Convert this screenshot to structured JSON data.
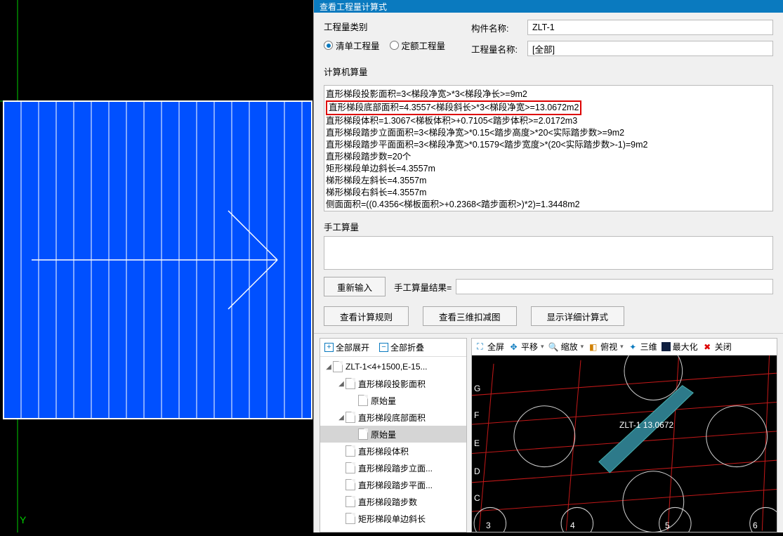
{
  "dialog": {
    "title": "查看工程量计算式"
  },
  "quantity_type": {
    "label": "工程量类别",
    "opt1": "清单工程量",
    "opt2": "定额工程量"
  },
  "fields": {
    "component_label": "构件名称:",
    "component_value": "ZLT-1",
    "quantity_name_label": "工程量名称:",
    "quantity_name_value": "[全部]"
  },
  "calc": {
    "label": "计算机算量",
    "lines": [
      "直形梯段投影面积=3<梯段净宽>*3<梯段净长>=9m2",
      "直形梯段底部面积=4.3557<梯段斜长>*3<梯段净宽>=13.0672m2",
      "直形梯段体积=1.3067<梯板体积>+0.7105<踏步体积>=2.0172m3",
      "直形梯段踏步立面面积=3<梯段净宽>*0.15<踏步高度>*20<实际踏步数>=9m2",
      "直形梯段踏步平面面积=3<梯段净宽>*0.1579<踏步宽度>*(20<实际踏步数>-1)=9m2",
      "直形梯段踏步数=20个",
      "矩形梯段单边斜长=4.3557m",
      "梯形梯段左斜长=4.3557m",
      "梯形梯段右斜长=4.3557m",
      "侧面面积=((0.4356<梯板面积>+0.2368<踏步面积>)*2)=1.3448m2"
    ],
    "highlight_index": 1
  },
  "manual": {
    "label": "手工算量",
    "reinput": "重新输入",
    "result_label": "手工算量结果="
  },
  "buttons": {
    "rule": "查看计算规则",
    "deduct": "查看三维扣减图",
    "detail": "显示详细计算式"
  },
  "tree_toolbar": {
    "expand": "全部展开",
    "collapse": "全部折叠"
  },
  "tree": [
    {
      "depth": 0,
      "tw": "◢",
      "label": "ZLT-1<4+1500,E-15..."
    },
    {
      "depth": 1,
      "tw": "◢",
      "label": "直形梯段投影面积"
    },
    {
      "depth": 2,
      "tw": "",
      "label": "原始量"
    },
    {
      "depth": 1,
      "tw": "◢",
      "label": "直形梯段底部面积"
    },
    {
      "depth": 2,
      "tw": "",
      "label": "原始量",
      "sel": true
    },
    {
      "depth": 1,
      "tw": "",
      "label": "直形梯段体积"
    },
    {
      "depth": 1,
      "tw": "",
      "label": "直形梯段踏步立面..."
    },
    {
      "depth": 1,
      "tw": "",
      "label": "直形梯段踏步平面..."
    },
    {
      "depth": 1,
      "tw": "",
      "label": "直形梯段踏步数"
    },
    {
      "depth": 1,
      "tw": "",
      "label": "矩形梯段单边斜长"
    }
  ],
  "view3d_toolbar": {
    "fullscreen": "全屏",
    "pan": "平移",
    "zoom": "缩放",
    "top": "俯视",
    "three": "三维",
    "max": "最大化",
    "close": "关闭"
  },
  "view3d": {
    "element_label": "ZLT-1 13.0672",
    "axis_y": [
      "G",
      "F",
      "E",
      "D",
      "C"
    ],
    "axis_x": [
      "3",
      "4",
      "5",
      "6"
    ]
  },
  "left_axis": {
    "y_label": "Y"
  }
}
